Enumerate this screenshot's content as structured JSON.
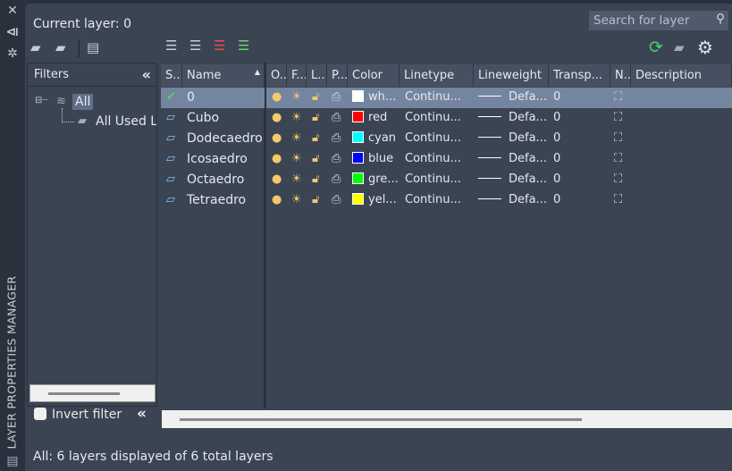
{
  "sidebar": {
    "title": "LAYER PROPERTIES MANAGER"
  },
  "header": {
    "current_layer": "Current layer: 0",
    "search_placeholder": "Search for layer"
  },
  "filters": {
    "title": "Filters",
    "tree": [
      {
        "label": "All",
        "selected": true
      },
      {
        "label": "All Used Layers"
      }
    ],
    "invert_label": "Invert filter",
    "invert_checked": false
  },
  "columns": [
    "S...",
    "Name",
    "O...",
    "F...",
    "L...",
    "P...",
    "Color",
    "Linetype",
    "Lineweight",
    "Transp...",
    "N...",
    "Description"
  ],
  "layers": [
    {
      "name": "0",
      "color": "wh...",
      "color_hex": "#ffffff",
      "linetype": "Continu...",
      "lineweight": "Defa...",
      "transparency": "0",
      "current": true
    },
    {
      "name": "Cubo",
      "color": "red",
      "color_hex": "#ff0000",
      "linetype": "Continu...",
      "lineweight": "Defa...",
      "transparency": "0"
    },
    {
      "name": "Dodecaedro",
      "color": "cyan",
      "color_hex": "#00ffff",
      "linetype": "Continu...",
      "lineweight": "Defa...",
      "transparency": "0"
    },
    {
      "name": "Icosaedro",
      "color": "blue",
      "color_hex": "#0000ff",
      "linetype": "Continu...",
      "lineweight": "Defa...",
      "transparency": "0"
    },
    {
      "name": "Octaedro",
      "color": "gre...",
      "color_hex": "#00ff00",
      "linetype": "Continu...",
      "lineweight": "Defa...",
      "transparency": "0"
    },
    {
      "name": "Tetraedro",
      "color": "yel...",
      "color_hex": "#ffff00",
      "linetype": "Continu...",
      "lineweight": "Defa...",
      "transparency": "0"
    }
  ],
  "status": "All: 6 layers displayed of 6 total layers"
}
